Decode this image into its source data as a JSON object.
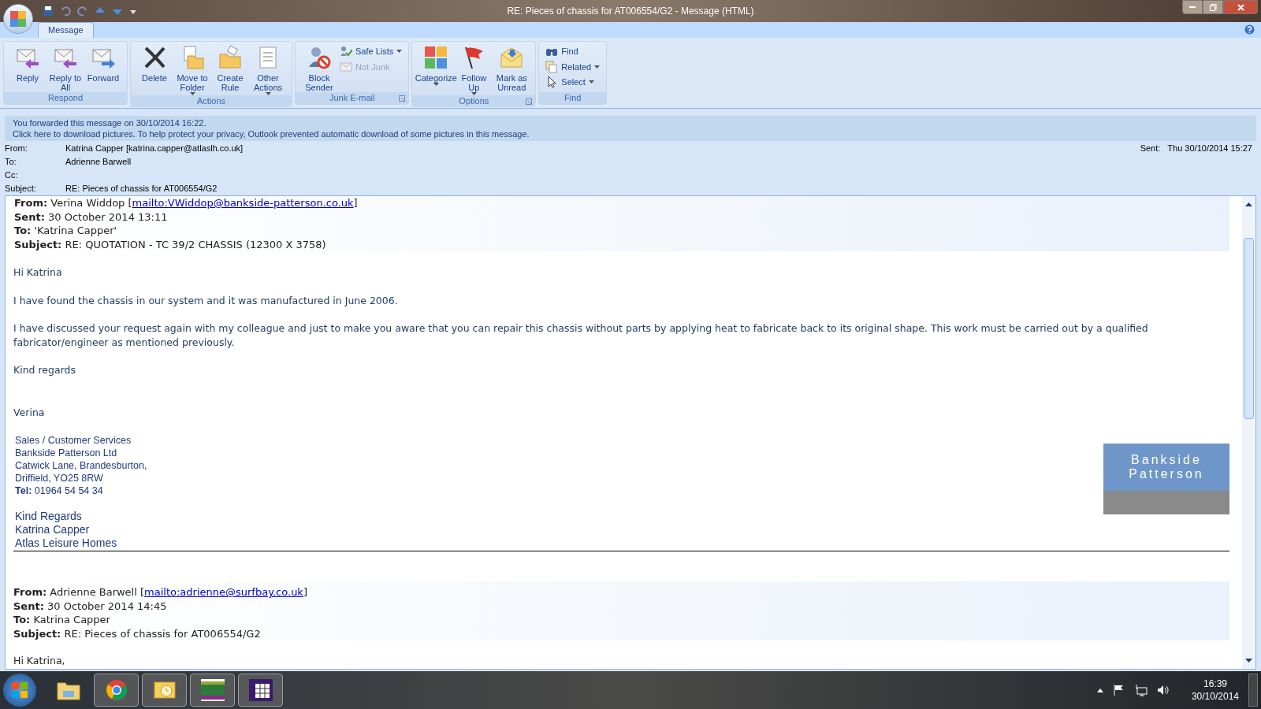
{
  "window": {
    "title": "RE: Pieces of chassis for AT006554/G2 - Message (HTML)"
  },
  "tabs": [
    {
      "label": "Message",
      "selected": true
    }
  ],
  "ribbon": [
    {
      "label": "Respond",
      "launcher": false,
      "buttons": [
        {
          "label": "Reply",
          "kind": "large",
          "menu": false,
          "disabled": false
        },
        {
          "label": "Reply to All",
          "kind": "large",
          "menu": false,
          "disabled": false
        },
        {
          "label": "Forward",
          "kind": "large",
          "menu": false,
          "disabled": false
        }
      ]
    },
    {
      "label": "Actions",
      "launcher": false,
      "buttons": [
        {
          "label": "Delete",
          "kind": "large",
          "menu": false,
          "disabled": false
        },
        {
          "label": "Move to Folder",
          "kind": "large",
          "menu": true,
          "disabled": false
        },
        {
          "label": "Create Rule",
          "kind": "large",
          "menu": false,
          "disabled": false
        },
        {
          "label": "Other Actions",
          "kind": "large",
          "menu": true,
          "disabled": false
        }
      ]
    },
    {
      "label": "Junk E-mail",
      "launcher": true,
      "buttons": [
        {
          "label": "Block Sender",
          "kind": "large",
          "menu": false,
          "disabled": false
        },
        {
          "label": "Safe Lists",
          "kind": "small",
          "menu": true,
          "disabled": false
        },
        {
          "label": "Not Junk",
          "kind": "small",
          "menu": false,
          "disabled": true
        }
      ]
    },
    {
      "label": "Options",
      "launcher": true,
      "buttons": [
        {
          "label": "Categorize",
          "kind": "large",
          "menu": true,
          "disabled": false
        },
        {
          "label": "Follow Up",
          "kind": "large",
          "menu": true,
          "disabled": false
        },
        {
          "label": "Mark as Unread",
          "kind": "large",
          "menu": false,
          "disabled": false
        }
      ]
    },
    {
      "label": "Find",
      "launcher": false,
      "buttons": [
        {
          "label": "Find",
          "kind": "small",
          "menu": false,
          "disabled": false
        },
        {
          "label": "Related",
          "kind": "small",
          "menu": true,
          "disabled": false
        },
        {
          "label": "Select",
          "kind": "small",
          "menu": true,
          "disabled": false
        }
      ]
    }
  ],
  "infobar": [
    "You forwarded this message on 30/10/2014 16:22.",
    "Click here to download pictures. To help protect your privacy, Outlook prevented automatic download of some pictures in this message."
  ],
  "header": {
    "fields": [
      {
        "label": "From:",
        "value": "Katrina Capper [katrina.capper@atlaslh.co.uk]"
      },
      {
        "label": "To:",
        "value": "Adrienne Barwell"
      },
      {
        "label": "Cc:"
      },
      {
        "label": "Subject:",
        "value": "RE: Pieces of chassis for AT006554/G2"
      }
    ],
    "sent_label": "Sent:",
    "sent_value": "Thu 30/10/2014 15:27"
  },
  "body": {
    "quote1": {
      "lines": [
        {
          "label": "From:",
          "value": "Verina Widdop [",
          "link": "mailto:VWiddop@bankside-patterson.co.uk",
          "tail": "]"
        },
        {
          "label": "Sent:",
          "value": "30 October 2014 13:11"
        },
        {
          "label": "To:",
          "value": "'Katrina Capper'"
        },
        {
          "label": "Subject:",
          "value": "RE: QUOTATION - TC 39/2 CHASSIS (12300 X 3758)"
        }
      ],
      "paragraphs": [
        "Hi Katrina",
        "I have found the chassis in our system and it was manufactured in June 2006.",
        "I have discussed your request again with my colleague and just to make you aware that you can repair this chassis without parts by applying heat to fabricate back to its original shape.  This work must be carried out by a qualified fabricator/engineer as mentioned previously.",
        "Kind regards"
      ],
      "name": "Verina",
      "signature": [
        "Sales / Customer Services",
        "Bankside Patterson Ltd",
        "Catwick Lane, Brandesburton,",
        "Driffield, YO25 8RW",
        "**Tel:** 01964 54 54 34"
      ],
      "logo": [
        "Bankside",
        "Patterson"
      ]
    },
    "closing": [
      "Kind Regards",
      "Katrina Capper",
      "Atlas Leisure Homes"
    ],
    "quote2": {
      "lines": [
        {
          "label": "From:",
          "value": "Adrienne Barwell [",
          "link": "mailto:adrienne@surfbay.co.uk",
          "tail": "]"
        },
        {
          "label": "Sent:",
          "value": "30 October 2014 14:45"
        },
        {
          "label": "To:",
          "value": "Katrina Capper"
        },
        {
          "label": "Subject:",
          "value": "RE: Pieces of chassis for AT006554/G2"
        }
      ],
      "paragraphs": [
        "Hi Katrina,"
      ]
    }
  },
  "taskbar": {
    "apps": [
      {
        "running": false
      },
      {
        "running": true
      },
      {
        "running": true
      },
      {
        "running": true
      },
      {
        "running": true
      }
    ],
    "time": "16:39",
    "date": "30/10/2014"
  }
}
